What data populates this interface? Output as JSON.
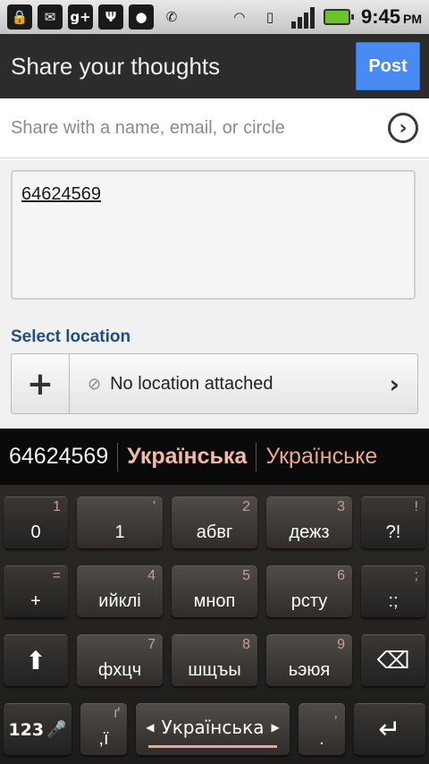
{
  "status_bar": {
    "left_icons": [
      "lock-icon",
      "mail-icon",
      "google-plus-icon",
      "usb-icon",
      "android-icon",
      "phone-icon"
    ],
    "google_plus_label": "g+",
    "time": "9:45",
    "ampm": "PM",
    "battery_color": "#6ac32a"
  },
  "header": {
    "title": "Share your thoughts",
    "post_label": "Post",
    "accent": "#4a8af4"
  },
  "share": {
    "placeholder": "Share with a name, email, or circle"
  },
  "post": {
    "text": "64624569"
  },
  "location": {
    "label": "Select location",
    "add_symbol": "+",
    "value": "No location attached"
  },
  "suggestions": [
    "64624569",
    "Українська",
    "Українське"
  ],
  "keyboard": {
    "rows": [
      [
        {
          "main": "0",
          "hint": "1"
        },
        {
          "main": "1",
          "hint": "'"
        },
        {
          "main": "абвг",
          "hint": "2"
        },
        {
          "main": "дежз",
          "hint": "3"
        },
        {
          "main": "?!",
          "hint": "!"
        }
      ],
      [
        {
          "main": "+",
          "hint": "="
        },
        {
          "main": "ийклі",
          "hint": "4"
        },
        {
          "main": "мноп",
          "hint": "5"
        },
        {
          "main": "рсту",
          "hint": "6"
        },
        {
          "main": ":;",
          "hint": ";"
        }
      ],
      [
        {
          "main": "",
          "hint": ""
        },
        {
          "main": "фхцч",
          "hint": "7"
        },
        {
          "main": "шщъы",
          "hint": "8"
        },
        {
          "main": "ьэюя",
          "hint": "9"
        },
        {
          "main": "",
          "hint": ""
        }
      ]
    ],
    "bottom": {
      "symbols_label": "123",
      "comma_main": ",ї",
      "comma_hint": "ґ",
      "language": "Українська",
      "period_main": ".",
      "period_hint": ","
    }
  }
}
